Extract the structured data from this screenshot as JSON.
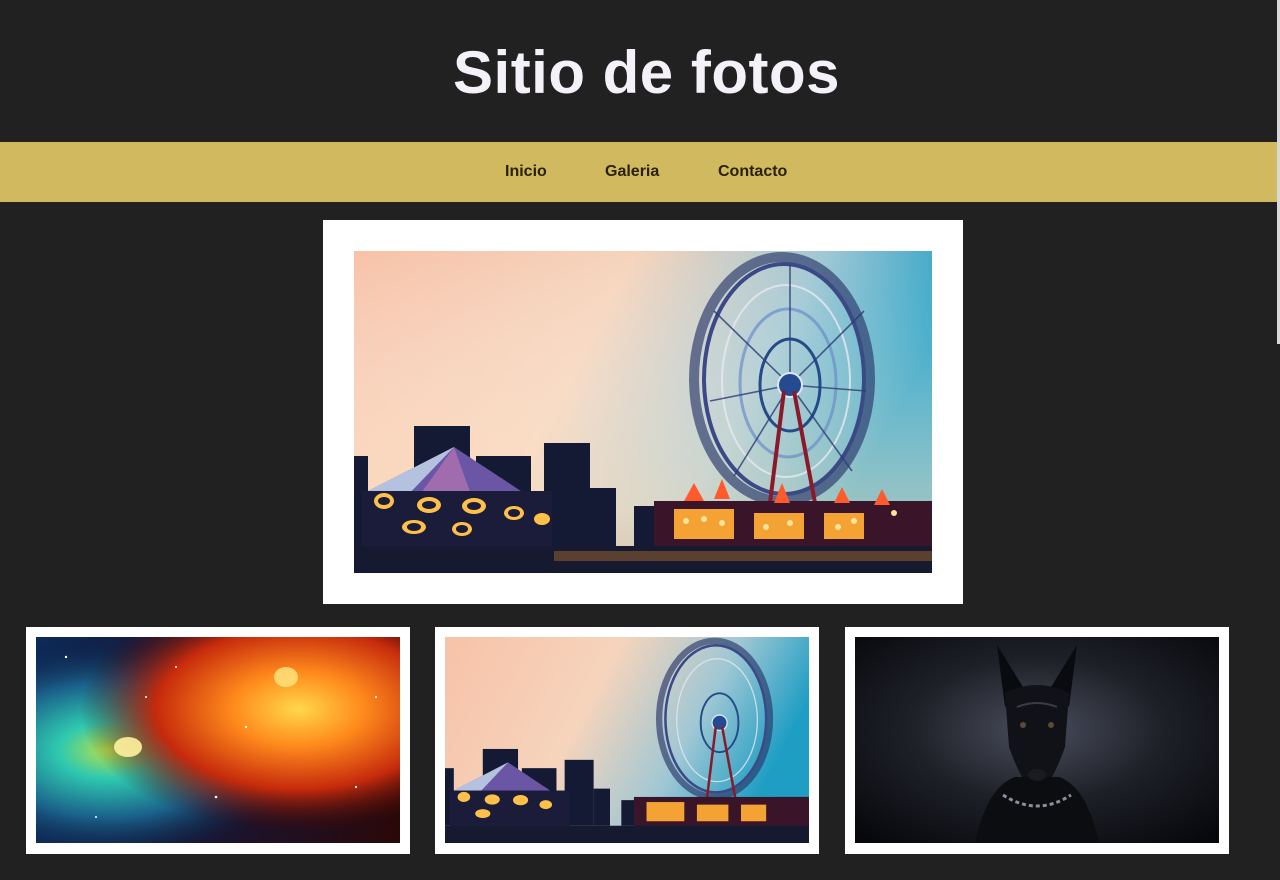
{
  "header": {
    "title": "Sitio de fotos"
  },
  "nav": {
    "items": [
      {
        "label": "Inicio"
      },
      {
        "label": "Galeria"
      },
      {
        "label": "Contacto"
      }
    ]
  },
  "hero": {
    "image": "ferris-wheel-fair-photo"
  },
  "gallery": {
    "thumbnails": [
      {
        "image": "nebula-space-photo"
      },
      {
        "image": "ferris-wheel-fair-photo"
      },
      {
        "image": "doberman-dog-photo"
      }
    ]
  },
  "colors": {
    "background": "#212121",
    "nav_background": "#d1b960",
    "title": "#f4f1f8",
    "nav_text": "#2a2100",
    "frame": "#ffffff"
  }
}
